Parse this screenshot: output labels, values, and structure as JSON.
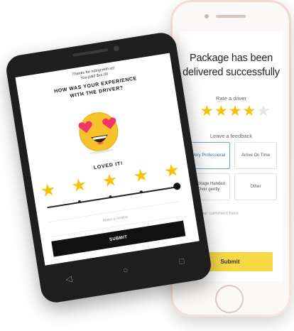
{
  "iphone": {
    "title": "Package has been delivered successfully",
    "rate_label": "Rate a driver",
    "stars": {
      "filled": 4,
      "total": 5
    },
    "feedback_label": "Leave a feedback",
    "feedback_options": [
      {
        "label": "Very Professional",
        "selected": true
      },
      {
        "label": "Arrive On Time",
        "selected": false
      },
      {
        "label": "Package Handed Over gently",
        "selected": false
      },
      {
        "label": "Other",
        "selected": false
      }
    ],
    "comment_placeholder": "Type your comment here",
    "submit_label": "Submit"
  },
  "android": {
    "thanks_line1": "Thanks for riding with us!",
    "thanks_line2": "You paid $xx.00",
    "question_line1": "HOW WAS YOUR EXPERIENCE",
    "question_line2": "WITH THE DRIVER?",
    "reaction_label": "LOVED IT!",
    "stars": {
      "filled": 5,
      "total": 5
    },
    "comment_placeholder": "Make a review",
    "submit_label": "SUBMIT"
  },
  "colors": {
    "star": "#f5c20b",
    "yellow_button": "#f7d946",
    "dark_button": "#111111",
    "selected_border": "#6aa4dc"
  }
}
